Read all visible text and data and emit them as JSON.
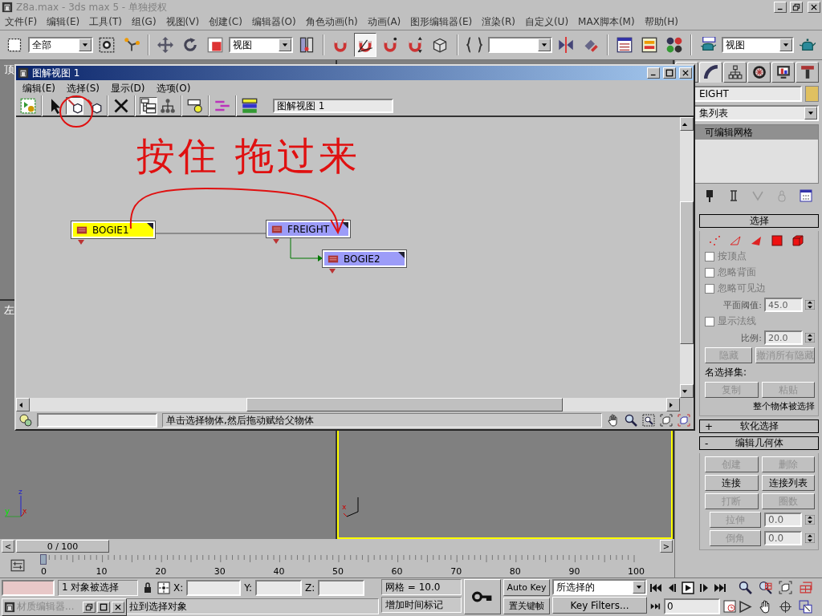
{
  "window": {
    "title": "Z8a.max - 3ds max 5 - 单独授权"
  },
  "menu": [
    "文件(F)",
    "编辑(E)",
    "工具(T)",
    "组(G)",
    "视图(V)",
    "创建(C)",
    "编辑器(O)",
    "角色动画(h)",
    "动画(A)",
    "图形编辑器(E)",
    "渲染(R)",
    "自定义(U)",
    "MAX脚本(M)",
    "帮助(H)"
  ],
  "main_toolbar": {
    "items": [
      {
        "kind": "tool",
        "selected": false
      },
      {
        "kind": "dropdown",
        "value": "全部"
      },
      {
        "kind": "tool",
        "selected": false
      },
      {
        "kind": "tool",
        "selected": false
      },
      {
        "kind": "separator"
      },
      {
        "kind": "tool",
        "selected": false
      },
      {
        "kind": "tool",
        "selected": false
      },
      {
        "kind": "tool",
        "selected": false
      },
      {
        "kind": "dropdown",
        "value": "视图"
      },
      {
        "kind": "tool",
        "selected": false
      },
      {
        "kind": "separator"
      },
      {
        "kind": "tool",
        "selected": false
      },
      {
        "kind": "tool",
        "selected": true
      },
      {
        "kind": "tool",
        "selected": false
      },
      {
        "kind": "tool",
        "selected": false
      },
      {
        "kind": "tool",
        "selected": false
      },
      {
        "kind": "separator"
      },
      {
        "kind": "tool",
        "selected": false
      },
      {
        "kind": "dropdown"
      },
      {
        "kind": "tool",
        "selected": false
      },
      {
        "kind": "tool",
        "selected": false
      },
      {
        "kind": "separator"
      },
      {
        "kind": "tool",
        "selected": false
      },
      {
        "kind": "tool",
        "selected": false
      },
      {
        "kind": "tool",
        "selected": false
      },
      {
        "kind": "separator"
      },
      {
        "kind": "tool",
        "selected": false
      },
      {
        "kind": "dropdown",
        "value": "视图"
      },
      {
        "kind": "tool",
        "selected": false
      }
    ]
  },
  "viewports": [
    {
      "label": "顶",
      "active": false
    },
    {
      "active": false
    },
    {
      "label": "左",
      "active": false,
      "axis_labels": [
        "z",
        "y",
        "x"
      ]
    },
    {
      "active": true,
      "axis_labels": [
        "x"
      ]
    }
  ],
  "time_slider": {
    "label": "0 / 100",
    "level": 0,
    "prev": "<",
    "next": ">"
  },
  "trackbar": {
    "ticks": [
      "0",
      "10",
      "20",
      "30",
      "40",
      "50",
      "60",
      "70",
      "80",
      "90",
      "100"
    ]
  },
  "command_panel": {
    "tabs": [
      {
        "selected": false
      },
      {
        "selected": true
      },
      {
        "selected": false
      },
      {
        "selected": false
      },
      {
        "selected": false
      },
      {
        "selected": false
      }
    ],
    "object_name": "EIGHT",
    "modifier_list": "集列表",
    "stack": [
      {
        "label": "可编辑网格",
        "selected": true
      }
    ],
    "selection_rollout": {
      "title": "选择",
      "items": [
        {
          "kind": "subobject_icons"
        },
        {
          "kind": "check",
          "label": "按顶点",
          "disabled": true
        },
        {
          "kind": "check",
          "label": "忽略背面",
          "disabled": true
        },
        {
          "kind": "check",
          "label": "忽略可见边",
          "disabled": true
        },
        {
          "kind": "spinner",
          "label": "平面阈值:",
          "value": "45.0",
          "disabled": true
        },
        {
          "kind": "check",
          "label": "显示法线",
          "disabled": true
        },
        {
          "kind": "spinner",
          "label": "比例:",
          "value": "20.0",
          "disabled": true
        },
        {
          "kind": "buttons",
          "buttons": [
            {
              "label": "隐藏",
              "disabled": true
            },
            {
              "label": "撤消所有隐藏",
              "disabled": true
            }
          ]
        },
        {
          "kind": "caption",
          "text": "名选择集:"
        },
        {
          "kind": "buttons",
          "buttons": [
            {
              "label": "复制",
              "disabled": true
            },
            {
              "label": "粘贴",
              "disabled": true
            }
          ]
        },
        {
          "kind": "status",
          "text": "整个物体被选择"
        }
      ]
    },
    "rollouts": [
      {
        "sign": "+",
        "title": "软化选择"
      },
      {
        "sign": "-",
        "title": "编辑几何体"
      }
    ],
    "edit_geometry": [
      {
        "kind": "buttons",
        "buttons": [
          {
            "label": "创建",
            "disabled": true
          },
          {
            "label": "删除",
            "disabled": true
          }
        ]
      },
      {
        "kind": "buttons",
        "buttons": [
          {
            "label": "连接",
            "disabled": false
          },
          {
            "label": "连接列表",
            "disabled": false
          }
        ]
      },
      {
        "kind": "buttons",
        "buttons": [
          {
            "label": "打断",
            "disabled": true
          },
          {
            "label": "圈数",
            "disabled": true
          }
        ]
      },
      {
        "kind": "spin_button",
        "label": "拉伸",
        "value": "0.0",
        "disabled": true
      },
      {
        "kind": "spin_button",
        "label": "倒角",
        "value": "0.0",
        "disabled": true
      }
    ]
  },
  "schematic": {
    "title": "图解视图 1",
    "menu": [
      "编辑(E)",
      "选择(S)",
      "显示(D)",
      "选项(O)"
    ],
    "toolbar": [
      {
        "kind": "tool",
        "selected": false
      },
      {
        "kind": "separator"
      },
      {
        "kind": "tool",
        "selected": false
      },
      {
        "kind": "tool",
        "selected": true
      },
      {
        "kind": "tool",
        "selected": false
      },
      {
        "kind": "separator"
      },
      {
        "kind": "tool",
        "selected": false
      },
      {
        "kind": "separator"
      },
      {
        "kind": "tool",
        "selected": true
      },
      {
        "kind": "tool",
        "selected": false
      },
      {
        "kind": "separator"
      },
      {
        "kind": "tool",
        "selected": false
      },
      {
        "kind": "separator"
      },
      {
        "kind": "tool",
        "selected": false
      },
      {
        "kind": "separator"
      },
      {
        "kind": "tool",
        "selected": false
      }
    ],
    "name_field": "图解视图 1",
    "nodes": [
      {
        "label": "BOGIE1",
        "selected": true
      },
      {
        "label": "FREIGHT",
        "selected": false
      },
      {
        "label": "BOGIE2",
        "selected": false
      }
    ],
    "prompt": "单击选择物体,然后拖动赋给父物体"
  },
  "annotation": {
    "text": "按住 拖过来"
  },
  "status": {
    "selection_info": "1 对象被选择",
    "coords": [
      "X:",
      "Y:",
      "Z:"
    ],
    "grid": "网格 = 10.0",
    "prompt": "拉到选择对象",
    "add_time_tag": "增加时间标记",
    "auto_key": "Auto Key",
    "set_key": "置关键帧",
    "key_mode": "所选择的",
    "key_filters": "Key Filters...",
    "frame": "0"
  },
  "material_editor": {
    "title": "材质编辑器..."
  }
}
